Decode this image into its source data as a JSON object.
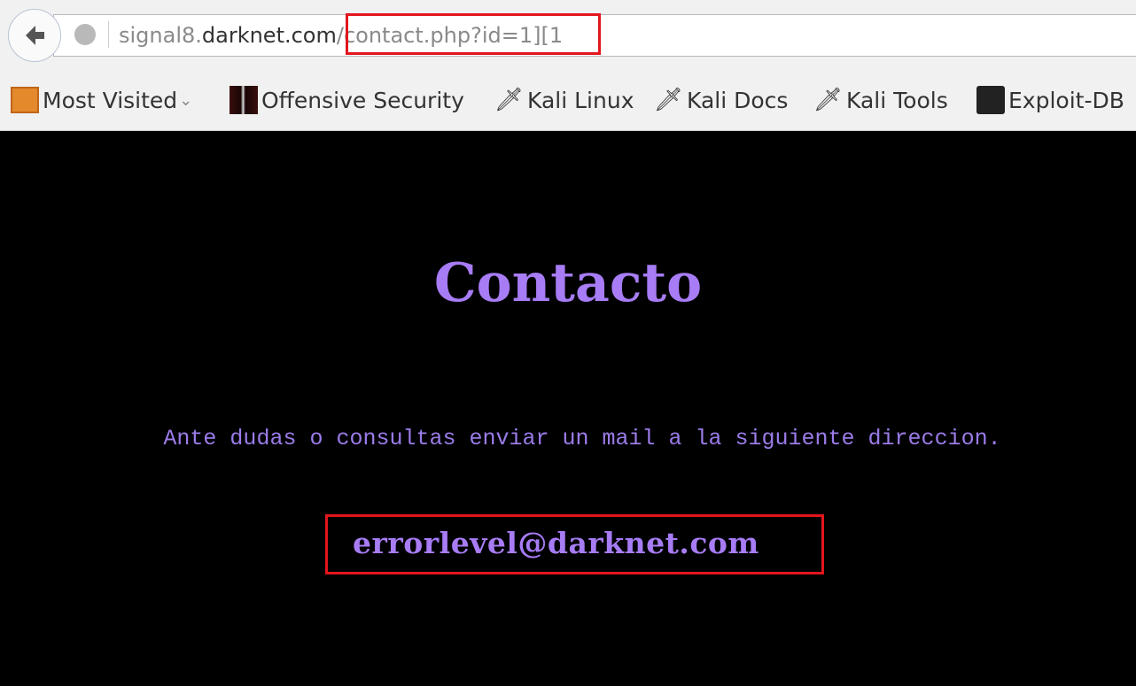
{
  "browser": {
    "url_host_prefix": "signal8.",
    "url_host": "darknet.com",
    "url_path": "/contact.php?id=1][1",
    "back_icon": "arrow-left-icon",
    "site_icon": "globe-icon",
    "highlight_color": "#e3151d"
  },
  "bookmarks": [
    {
      "label": "Most Visited",
      "icon": "folder-icon",
      "dropdown": true
    },
    {
      "label": "Offensive Security",
      "icon": "offsec-icon"
    },
    {
      "label": "Kali Linux",
      "icon": "kali-dragon-icon"
    },
    {
      "label": "Kali Docs",
      "icon": "kali-dragon-icon"
    },
    {
      "label": "Kali Tools",
      "icon": "kali-dragon-icon"
    },
    {
      "label": "Exploit-DB",
      "icon": "exploitdb-icon"
    }
  ],
  "page": {
    "title": "Contacto",
    "message": "Ante dudas o consultas enviar un mail a la siguiente direccion.",
    "email": "errorlevel@darknet.com",
    "text_color": "#a77cf5",
    "background": "#000000"
  }
}
